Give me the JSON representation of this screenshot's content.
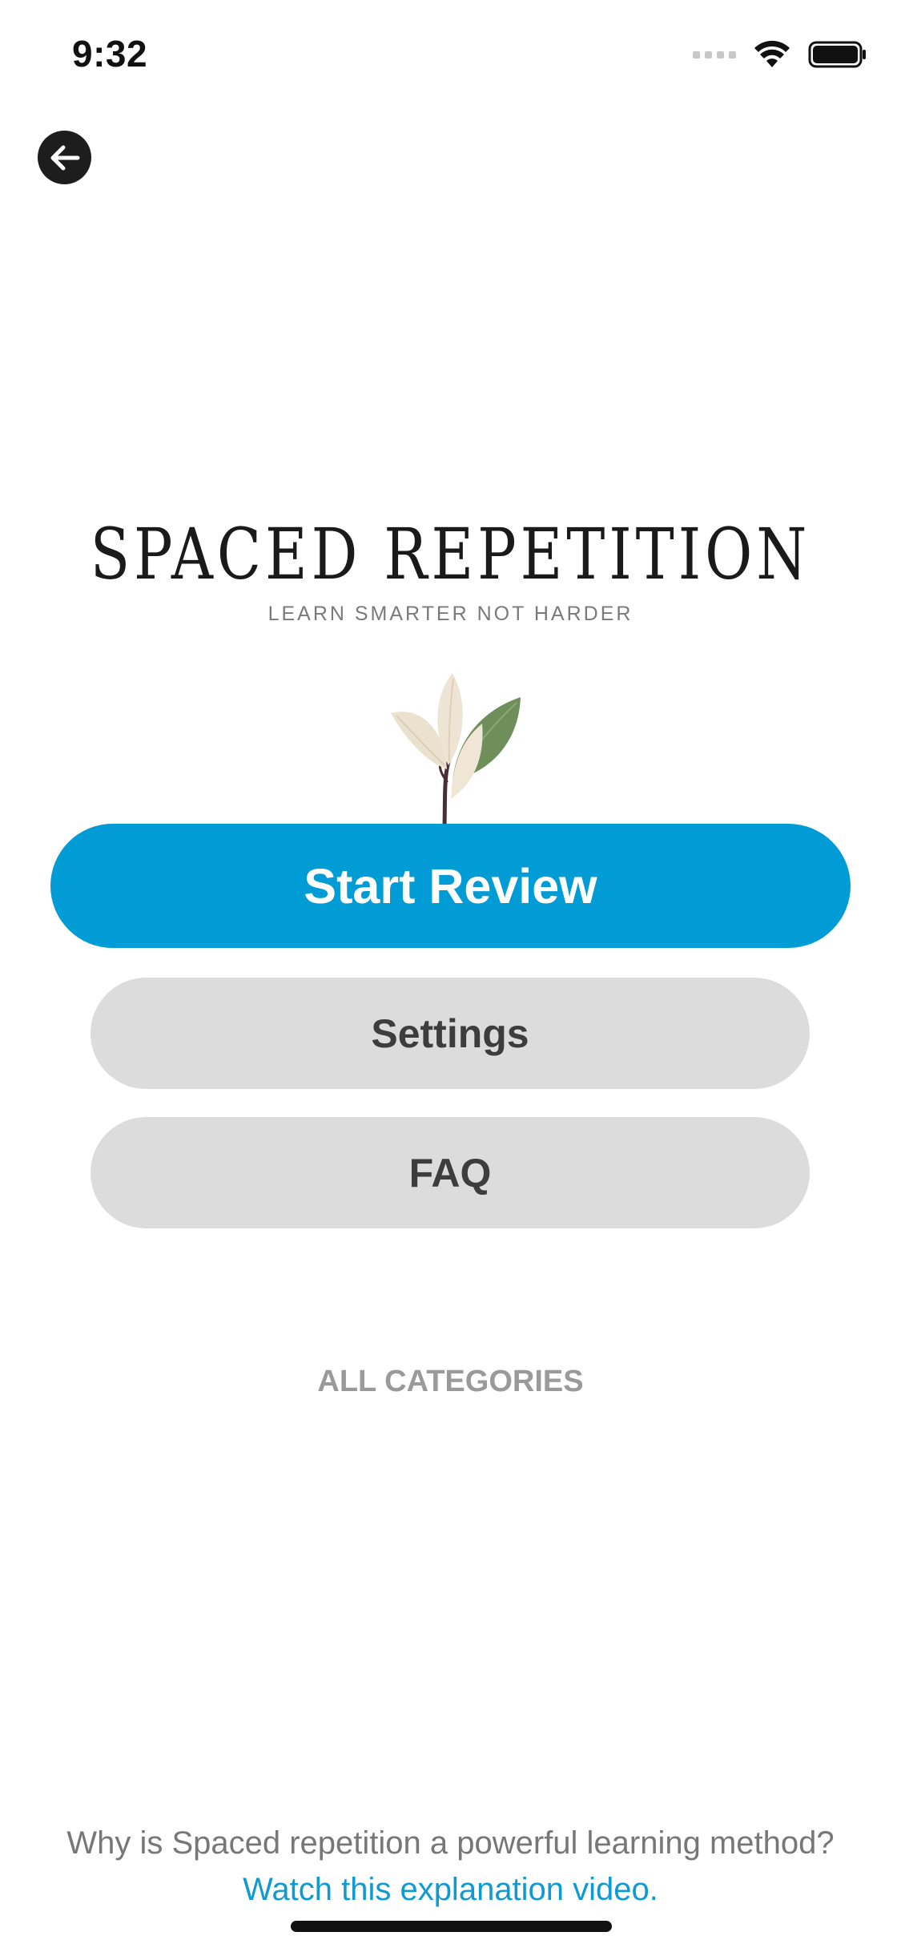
{
  "status_bar": {
    "time": "9:32"
  },
  "header": {
    "back_icon": "arrow-left-icon"
  },
  "logo": {
    "title": "SPACED REPETITION",
    "subtitle": "LEARN SMARTER NOT HARDER"
  },
  "actions": {
    "start_review_label": "Start Review",
    "settings_label": "Settings",
    "faq_label": "FAQ"
  },
  "categories": {
    "label": "ALL CATEGORIES"
  },
  "footer": {
    "question": "Why is Spaced repetition a powerful learning method?",
    "link": "Watch this explanation video."
  },
  "colors": {
    "primary": "#019bd6",
    "secondary_bg": "#dcdcdc",
    "link": "#0f9ad3"
  }
}
